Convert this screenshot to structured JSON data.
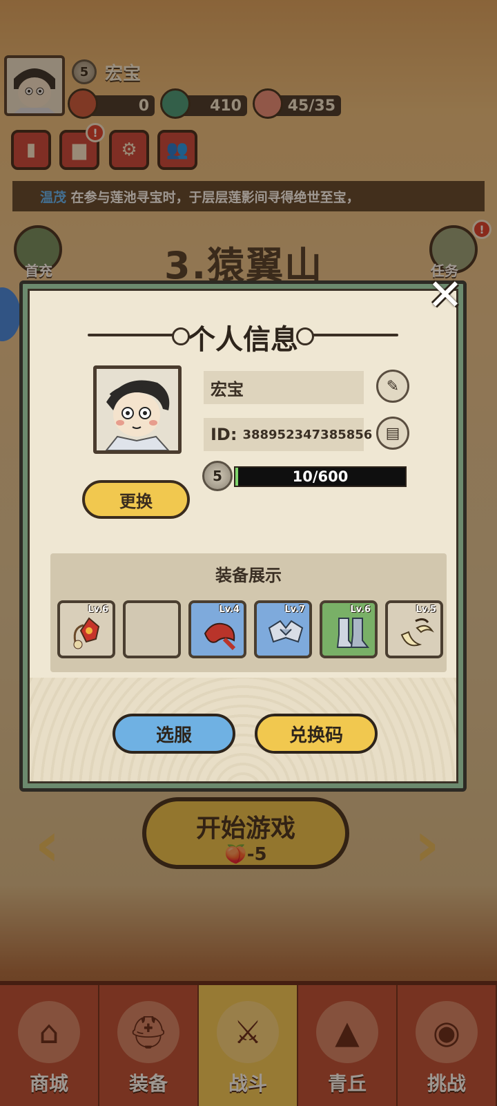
{
  "player": {
    "name": "宏宝",
    "level": "5"
  },
  "resources": [
    {
      "name": "ticket",
      "value": "0"
    },
    {
      "name": "fish",
      "value": "410"
    },
    {
      "name": "peach",
      "value": "45/35"
    }
  ],
  "marquee": {
    "highlight": "温茂",
    "text": "在参与莲池寻宝时，于层层莲影间寻得绝世至宝，"
  },
  "stage": {
    "title": "3.猿翼山"
  },
  "side": {
    "left_label": "首充",
    "right_label": "任务"
  },
  "start": {
    "label": "开始游戏",
    "cost": "-5"
  },
  "tabs": [
    {
      "label": "商城",
      "icon": "shop-icon"
    },
    {
      "label": "装备",
      "icon": "helmet-icon"
    },
    {
      "label": "战斗",
      "icon": "crossed-swords-icon",
      "active": true
    },
    {
      "label": "青丘",
      "icon": "mountain-icon"
    },
    {
      "label": "挑战",
      "icon": "challenge-icon"
    }
  ],
  "modal": {
    "title": "个人信息",
    "name": "宏宝",
    "id_label": "ID:",
    "id_value": "388952347385856",
    "level": "5",
    "xp_text": "10/600",
    "xp_fraction": 0.017,
    "change_label": "更换",
    "equip_title": "装备展示",
    "equipment": [
      {
        "lv": "Lv.6",
        "rarity": "normal",
        "item": "red-flower-necklace"
      },
      {
        "lv": "",
        "rarity": "empty",
        "item": ""
      },
      {
        "lv": "Lv.4",
        "rarity": "blue",
        "item": "red-scarf"
      },
      {
        "lv": "Lv.7",
        "rarity": "blue",
        "item": "armor-shoulder"
      },
      {
        "lv": "Lv.6",
        "rarity": "green",
        "item": "armor-boots"
      },
      {
        "lv": "Lv.5",
        "rarity": "normal",
        "item": "horn-ornament"
      }
    ],
    "server_label": "选服",
    "code_label": "兑换码"
  },
  "colors": {
    "accent_yellow": "#f1c84f",
    "accent_blue": "#6fb1e3",
    "frame_green": "#6c8a6e",
    "xp_green": "#7ed36b"
  }
}
